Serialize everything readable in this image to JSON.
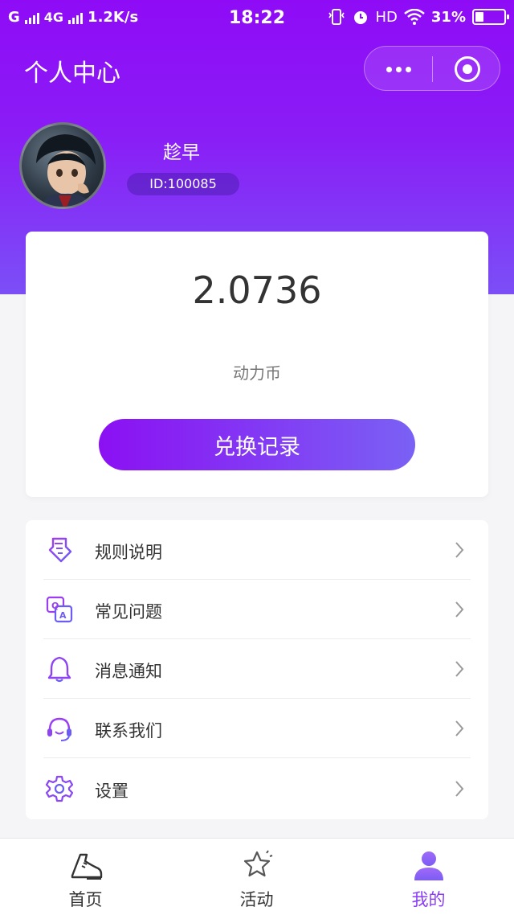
{
  "status_bar": {
    "carrier_left": "G",
    "network": "4G",
    "speed": "1.2K/s",
    "time": "18:22",
    "hd": "HD",
    "battery": "31%"
  },
  "nav": {
    "title": "个人中心"
  },
  "user": {
    "name": "趁早",
    "id": "ID:100085"
  },
  "balance": {
    "value": "2.0736",
    "label": "动力币",
    "button_label": "兑换记录"
  },
  "menu": {
    "items": [
      {
        "label": "规则说明",
        "icon": "document-icon"
      },
      {
        "label": "常见问题",
        "icon": "qa-icon"
      },
      {
        "label": "消息通知",
        "icon": "bell-icon"
      },
      {
        "label": "联系我们",
        "icon": "headset-icon"
      },
      {
        "label": "设置",
        "icon": "gear-icon"
      }
    ]
  },
  "tabs": [
    {
      "label": "首页",
      "icon": "shoe-icon"
    },
    {
      "label": "活动",
      "icon": "star-icon"
    },
    {
      "label": "我的",
      "icon": "person-icon",
      "active": true
    }
  ],
  "colors": {
    "accent": "#8a3cf6",
    "header_top": "#8f0bf6",
    "header_bottom": "#7b4ff7"
  }
}
